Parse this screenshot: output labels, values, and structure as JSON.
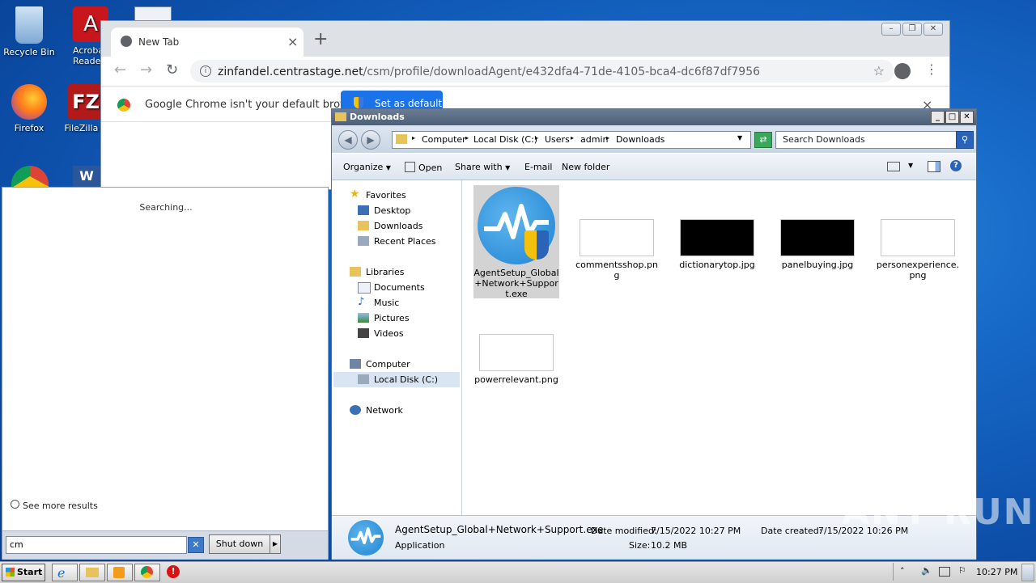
{
  "desktop": {
    "icons": [
      {
        "label": "Recycle Bin"
      },
      {
        "label": "Acroba Reader"
      },
      {
        "label": "Firefox"
      },
      {
        "label": "FileZilla C"
      }
    ]
  },
  "chrome": {
    "tab_title": "New Tab",
    "url_host": "zinfandel.centrastage.net",
    "url_path": "/csm/profile/downloadAgent/e432dfa4-71de-4105-bca4-dc6f87df7956",
    "infobar_message": "Google Chrome isn't your default browser",
    "set_default_label": "Set as default"
  },
  "startmenu": {
    "status": "Searching...",
    "see_more": "See more results",
    "search_value": "cm",
    "shutdown_label": "Shut down"
  },
  "explorer": {
    "title": "Downloads",
    "breadcrumbs": [
      "Computer",
      "Local Disk (C:)",
      "Users",
      "admin",
      "Downloads"
    ],
    "search_placeholder": "Search Downloads",
    "commands": {
      "organize": "Organize",
      "open": "Open",
      "share_with": "Share with",
      "email": "E-mail",
      "new_folder": "New folder"
    },
    "nav": {
      "favorites": "Favorites",
      "desktop": "Desktop",
      "downloads": "Downloads",
      "recent": "Recent Places",
      "libraries": "Libraries",
      "documents": "Documents",
      "music": "Music",
      "pictures": "Pictures",
      "videos": "Videos",
      "computer": "Computer",
      "local_disk": "Local Disk (C:)",
      "network": "Network"
    },
    "files": [
      {
        "name": "AgentSetup_Global+Network+Support.exe",
        "kind": "exe"
      },
      {
        "name": "commentsshop.png",
        "kind": "white"
      },
      {
        "name": "dictionarytop.jpg",
        "kind": "black"
      },
      {
        "name": "panelbuying.jpg",
        "kind": "black"
      },
      {
        "name": "personexperience.png",
        "kind": "white"
      },
      {
        "name": "powerrelevant.png",
        "kind": "white"
      }
    ],
    "details": {
      "filename": "AgentSetup_Global+Network+Support.exe",
      "type": "Application",
      "date_modified_label": "Date modified:",
      "date_modified": "7/15/2022 10:27 PM",
      "date_created_label": "Date created:",
      "date_created": "7/15/2022 10:26 PM",
      "size_label": "Size:",
      "size": "10.2 MB"
    }
  },
  "taskbar": {
    "start_label": "Start",
    "clock": "10:27 PM"
  },
  "watermark": "ANY RUN",
  "colors": {
    "desktop_blue": "#1667c6",
    "chrome_accent": "#1a73e8",
    "selection": "#d3d3d3"
  }
}
